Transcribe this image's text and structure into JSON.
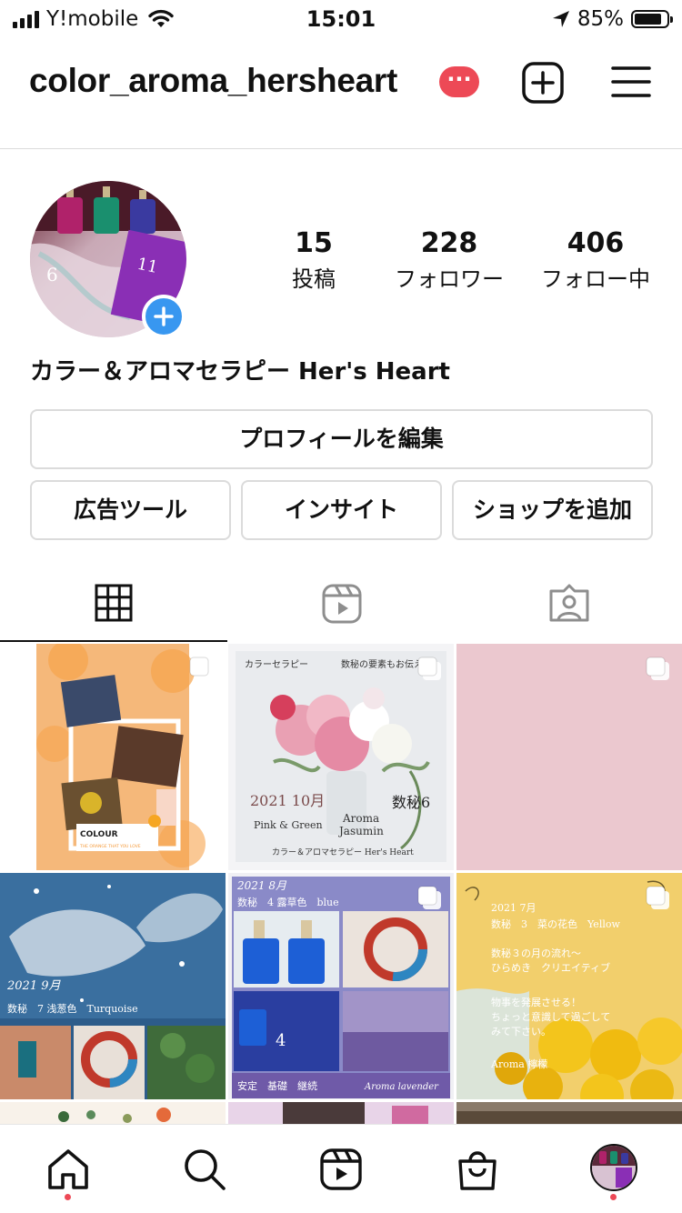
{
  "status_bar": {
    "carrier": "Y!mobile",
    "time": "15:01",
    "battery_percent": "85%",
    "battery_level": 0.85
  },
  "header": {
    "username": "color_aroma_hersheart",
    "badge_text": "···",
    "add_icon": "plus-square-icon",
    "menu_icon": "hamburger-menu-icon"
  },
  "profile": {
    "stats": [
      {
        "value": "15",
        "label": "投稿"
      },
      {
        "value": "228",
        "label": "フォロワー"
      },
      {
        "value": "406",
        "label": "フォロー中"
      }
    ],
    "name": "カラー＆アロマセラピー Her's Heart",
    "edit_button": "プロフィールを編集",
    "ad_tools_button": "広告ツール",
    "insights_button": "インサイト",
    "add_shop_button": "ショップを追加"
  },
  "tabs": [
    {
      "icon": "grid-icon",
      "active": true
    },
    {
      "icon": "reels-icon",
      "active": false
    },
    {
      "icon": "tagged-icon",
      "active": false
    }
  ],
  "posts": {
    "p1": {
      "label": "COLOUR",
      "caption": "THE ORANGE THAT YOU LOVE"
    },
    "p2": {
      "top_left": "カラーセラピー",
      "top_right": "数秘の要素もお伝え",
      "date": "2021 10月",
      "num": "数秘6",
      "pg": "Pink & Green",
      "aroma": "Aroma\nJasumin",
      "footer": "カラー＆アロマセラピー Her's Heart"
    },
    "p4": {
      "date": "2021 9月",
      "line": "数秘　7 浅葱色　Turquoise"
    },
    "p5": {
      "date": "2021 8月",
      "line": "数秘　4 露草色　blue",
      "footer": "安定　基礎　継続",
      "footer_right": "Aroma lavender"
    },
    "p6": {
      "date": "2021 7月",
      "line1": "数秘　3　菜の花色　Yellow",
      "line2": "数秘３の月の流れ〜",
      "line3": "ひらめき　クリエイティブ",
      "line4": "物事を発展させる！",
      "line5": "ちょっと意識して過ごして",
      "line6": "みて下さい。",
      "aroma": "Aroma 檸檬"
    }
  },
  "bottom_nav": [
    {
      "icon": "home-icon"
    },
    {
      "icon": "search-icon"
    },
    {
      "icon": "reels-icon"
    },
    {
      "icon": "shop-bag-icon"
    },
    {
      "icon": "profile-avatar"
    }
  ],
  "colors": {
    "accent_blue": "#3897f0",
    "badge_red": "#ed4956",
    "border": "#dbdbdb"
  }
}
